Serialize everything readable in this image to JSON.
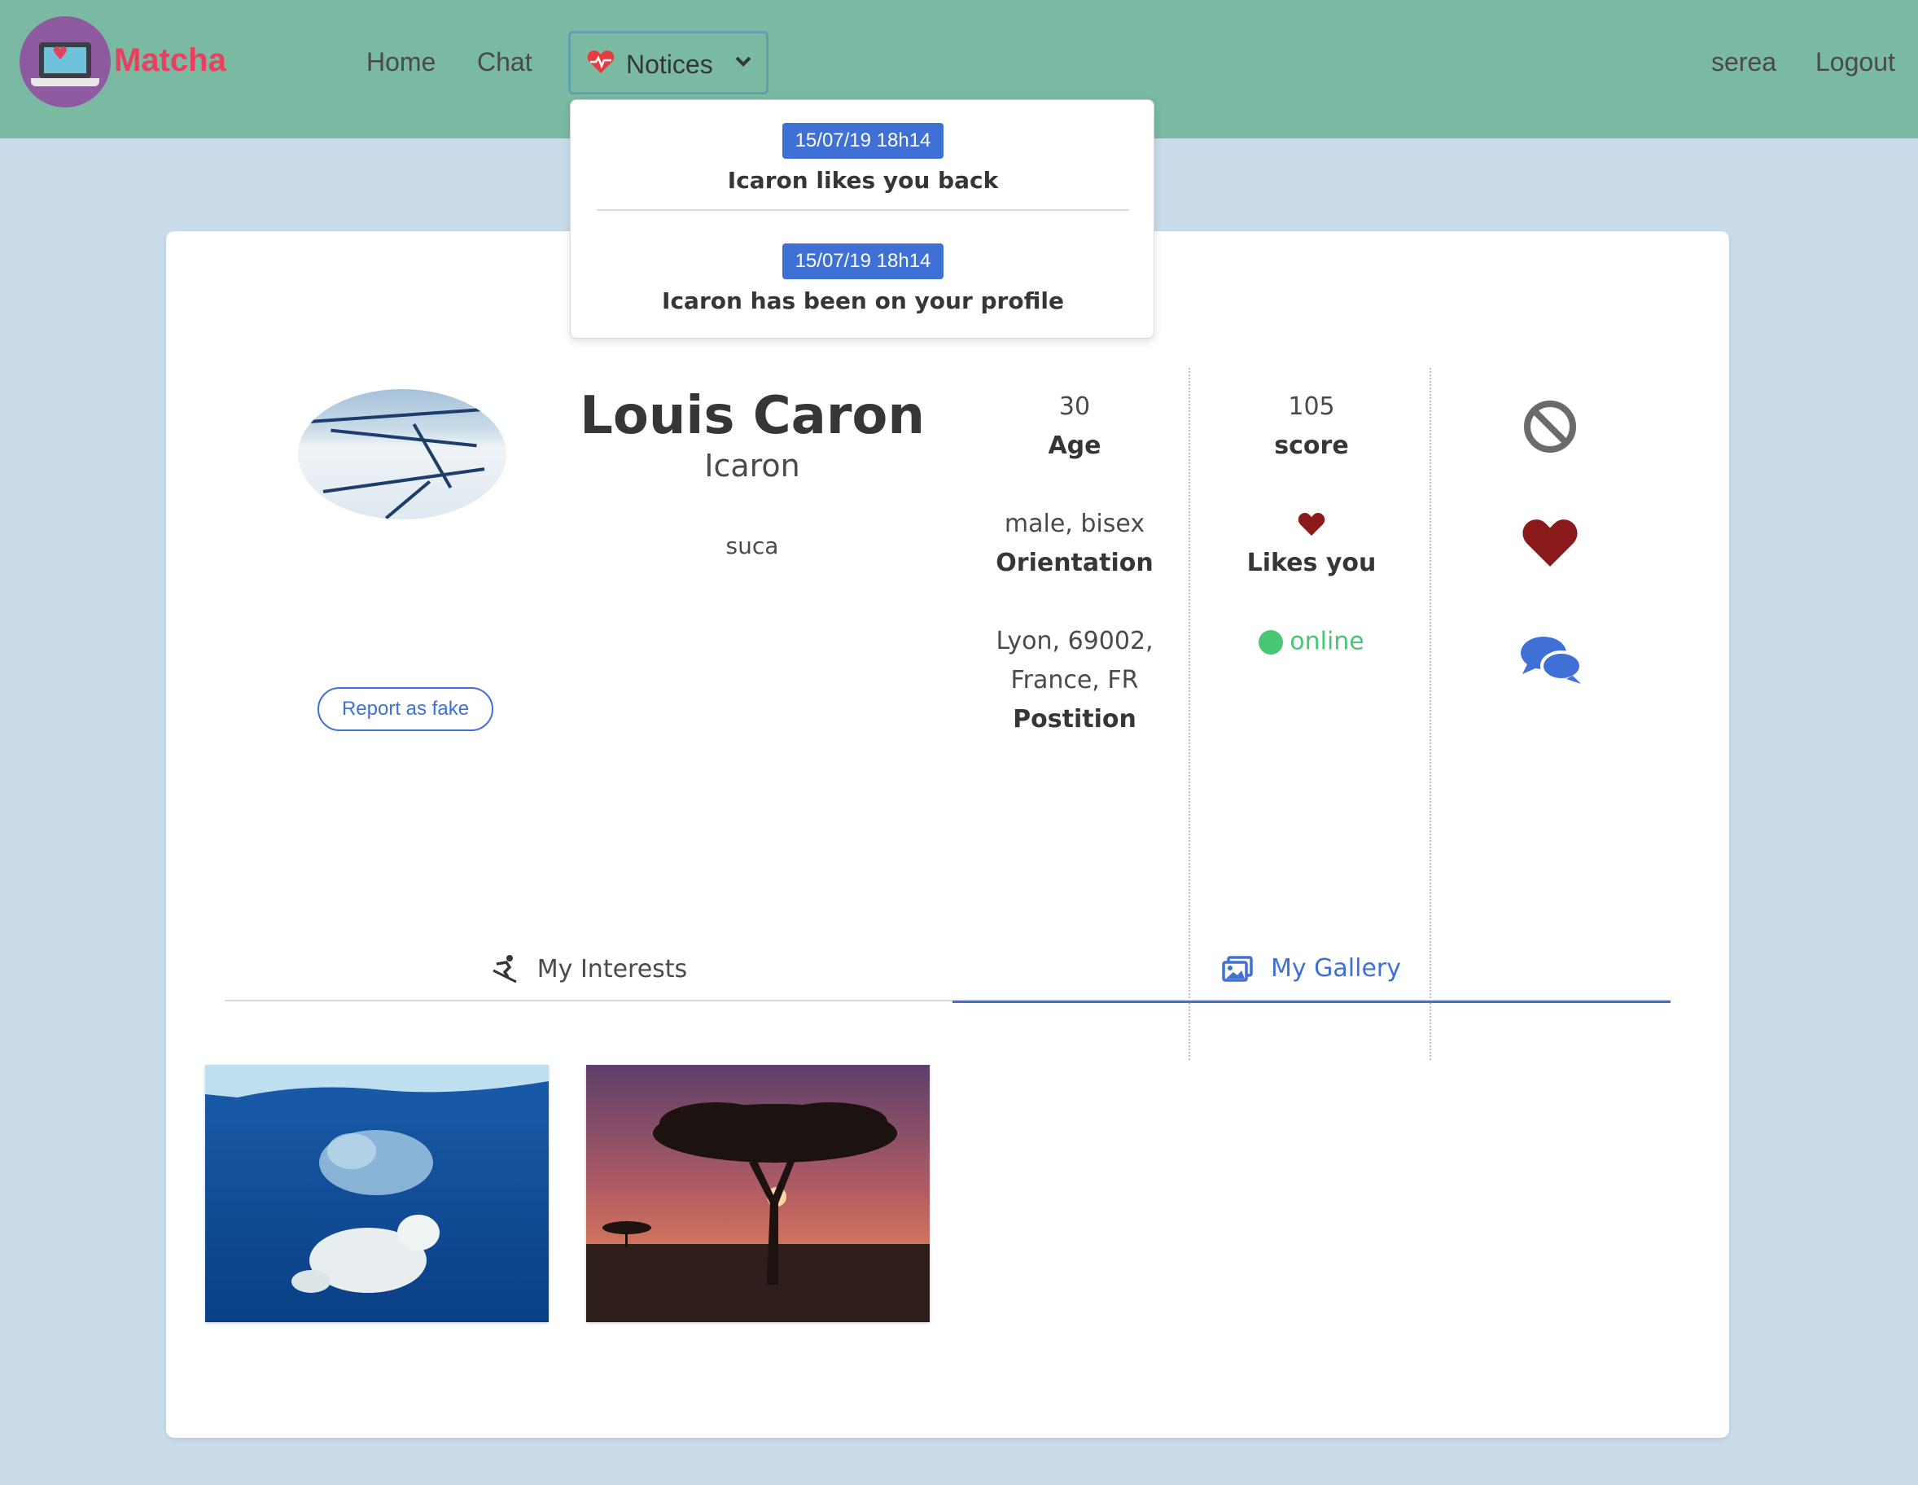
{
  "brand": {
    "name": "Matcha",
    "color": "#e8405f"
  },
  "nav": {
    "home": "Home",
    "chat": "Chat",
    "notices": "Notices",
    "user": "serea",
    "logout": "Logout"
  },
  "notifications": [
    {
      "date": "15/07/19 18h14",
      "message": "Icaron likes you back"
    },
    {
      "date": "15/07/19 18h14",
      "message": "Icaron has been on your profile"
    }
  ],
  "profile": {
    "name": "Louis Caron",
    "username": "Icaron",
    "bio": "suca",
    "report_label": "Report as fake",
    "age_value": "30",
    "age_label": "Age",
    "orientation_value": "male, bisex",
    "orientation_label": "Orientation",
    "position_value_line1": "Lyon, 69002,",
    "position_value_line2": "France, FR",
    "position_label": "Postition",
    "score_value": "105",
    "score_label": "score",
    "likes_label": "Likes you",
    "status": "online"
  },
  "actions": [
    {
      "icon": "block-icon"
    },
    {
      "icon": "heart-like-icon"
    },
    {
      "icon": "chat-bubbles-icon"
    }
  ],
  "tabs": {
    "interests": "My Interests",
    "gallery": "My Gallery",
    "active": "gallery"
  },
  "gallery": [
    {
      "description": "polar-bear-underwater"
    },
    {
      "description": "acacia-tree-sunset"
    }
  ],
  "colors": {
    "navbar": "#7ab9a2",
    "background": "#cadcea",
    "accent": "#3e70d6",
    "online": "#48c774",
    "heart": "#8b1a1a"
  }
}
